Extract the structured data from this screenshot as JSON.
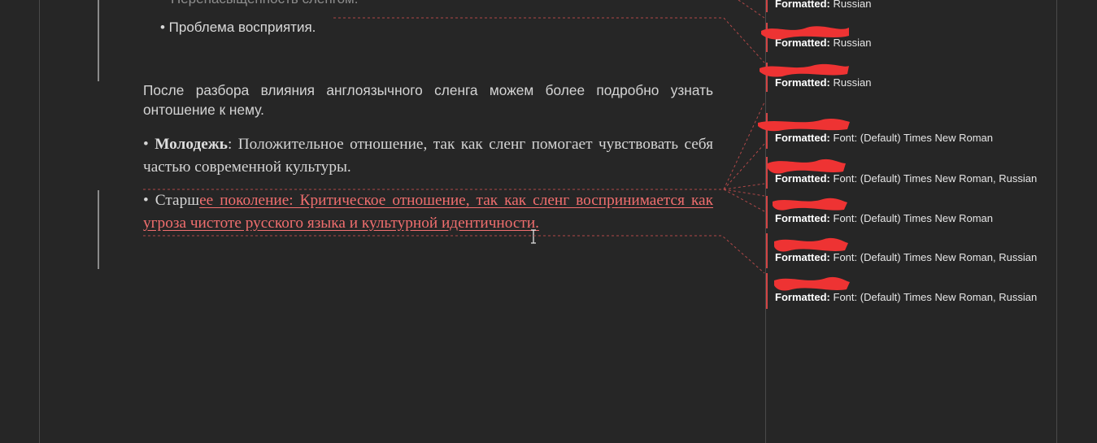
{
  "document": {
    "cut_line_text": "Перенасыщенность сленгом.",
    "bullet_perception": "• Проблема восприятия.",
    "intro_paragraph": "После разбора влияния англоязычного сленга можем более подробно узнать онтошение к нему.",
    "youth_bullet": "•",
    "youth_label": "Молодежь",
    "youth_text": ": Положительное отношение, так как сленг помогает чувствовать себя частью современной культуры.",
    "older_bullet_prefix": "•   Старш",
    "older_inserted_text": "ее поколение: Критическое отношение, так как сленг воспринимается как угроза чистоте русского языка и культурной идентичности."
  },
  "markup_pane": {
    "comments": [
      {
        "label": "Formatted:",
        "detail": "Russian"
      },
      {
        "label": "Formatted:",
        "detail": "Russian"
      },
      {
        "label": "Formatted:",
        "detail": "Russian"
      },
      {
        "label": "Formatted:",
        "detail": "Font: (Default) Times New Roman"
      },
      {
        "label": "Formatted:",
        "detail": "Font: (Default) Times New Roman, Russian"
      },
      {
        "label": "Formatted:",
        "detail": "Font: (Default) Times New Roman"
      },
      {
        "label": "Formatted:",
        "detail": "Font: (Default) Times New Roman, Russian"
      },
      {
        "label": "Formatted:",
        "detail": "Font: (Default) Times New Roman, Russian"
      }
    ]
  },
  "colors": {
    "background": "#262626",
    "inserted_text": "#f06e6e",
    "change_marker": "#d24444",
    "redaction": "#ee3333"
  },
  "icons": {
    "cursor": "i-beam-cursor-icon"
  }
}
